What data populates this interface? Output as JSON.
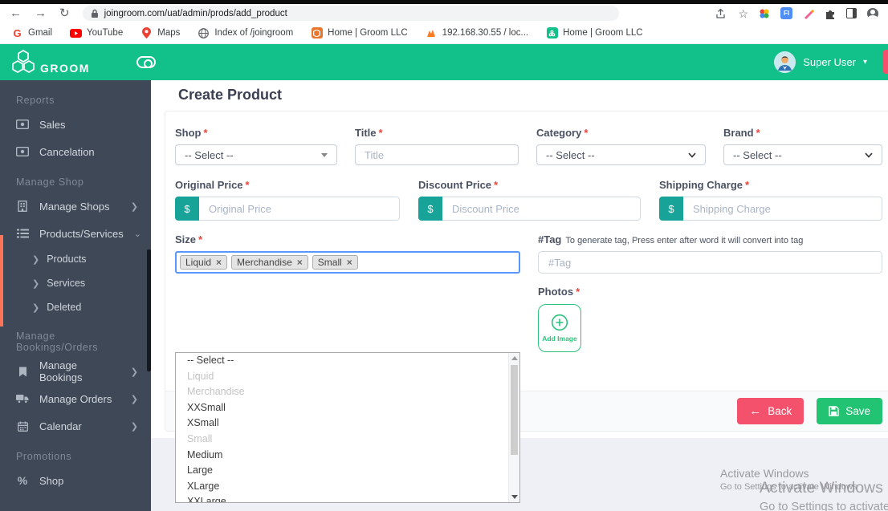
{
  "browser": {
    "url": "joingroom.com/uat/admin/prods/add_product",
    "bookmarks": [
      {
        "label": "Gmail"
      },
      {
        "label": "YouTube"
      },
      {
        "label": "Maps"
      },
      {
        "label": "Index of /joingroom"
      },
      {
        "label": "Home | Groom LLC"
      },
      {
        "label": "192.168.30.55 / loc..."
      },
      {
        "label": "Home | Groom LLC"
      }
    ]
  },
  "header": {
    "brand": "GROOM",
    "user_name": "Super User"
  },
  "sidebar": {
    "section_reports": "Reports",
    "sales": "Sales",
    "cancelation": "Cancelation",
    "section_manage_shop": "Manage Shop",
    "manage_shops": "Manage Shops",
    "products_services": "Products/Services",
    "sub_products": "Products",
    "sub_services": "Services",
    "sub_deleted": "Deleted",
    "section_bookings": "Manage Bookings/Orders",
    "manage_bookings": "Manage Bookings",
    "manage_orders": "Manage Orders",
    "calendar": "Calendar",
    "section_promotions": "Promotions",
    "shop": "Shop"
  },
  "form": {
    "page_title": "Create Product",
    "required_marker": "*",
    "shop": {
      "label": "Shop",
      "value": "-- Select --"
    },
    "product_title": {
      "label": "Title",
      "placeholder": "Title"
    },
    "category": {
      "label": "Category",
      "value": "-- Select --"
    },
    "brand": {
      "label": "Brand",
      "value": "-- Select --"
    },
    "original_price": {
      "label": "Original Price",
      "prefix": "$",
      "placeholder": "Original Price"
    },
    "discount_price": {
      "label": "Discount Price",
      "prefix": "$",
      "placeholder": "Discount Price"
    },
    "shipping_charge": {
      "label": "Shipping Charge",
      "prefix": "$",
      "placeholder": "Shipping Charge"
    },
    "size": {
      "label": "Size",
      "tags": [
        "Liquid",
        "Merchandise",
        "Small"
      ],
      "options": [
        "-- Select --",
        "Liquid",
        "Merchandise",
        "XXSmall",
        "XSmall",
        "Small",
        "Medium",
        "Large",
        "XLarge",
        "XXLarge"
      ]
    },
    "tag": {
      "label": "#Tag",
      "hint": "To generate tag, Press enter after word it will convert into tag",
      "placeholder": "#Tag"
    },
    "photos": {
      "label": "Photos",
      "add_image": "Add Image"
    },
    "back_button": "Back",
    "save_button": "Save"
  },
  "watermark": {
    "line1": "Activate Windows",
    "line2": "Go to Settings to activate Windows"
  }
}
